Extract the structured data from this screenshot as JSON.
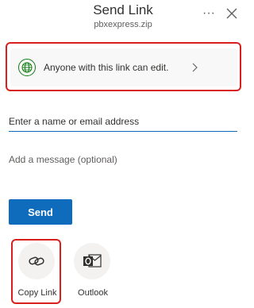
{
  "header": {
    "title": "Send Link",
    "subtitle": "pbxexpress.zip",
    "more_label": "···",
    "more_icon": "more-icon",
    "close_icon": "close-icon"
  },
  "link_settings": {
    "text": "Anyone with this link can edit.",
    "icon": "globe-icon",
    "chevron_icon": "chevron-right-icon"
  },
  "recipient": {
    "placeholder": "Enter a name or email address",
    "value": ""
  },
  "message": {
    "placeholder": "Add a message (optional)",
    "value": ""
  },
  "send_button": {
    "label": "Send"
  },
  "share_options": [
    {
      "label": "Copy Link",
      "icon": "link-icon"
    },
    {
      "label": "Outlook",
      "icon": "outlook-icon"
    }
  ],
  "colors": {
    "accent": "#0f6cbd",
    "highlight": "#d9201f",
    "globe": "#107c10",
    "panel": "#f8f8f8"
  }
}
